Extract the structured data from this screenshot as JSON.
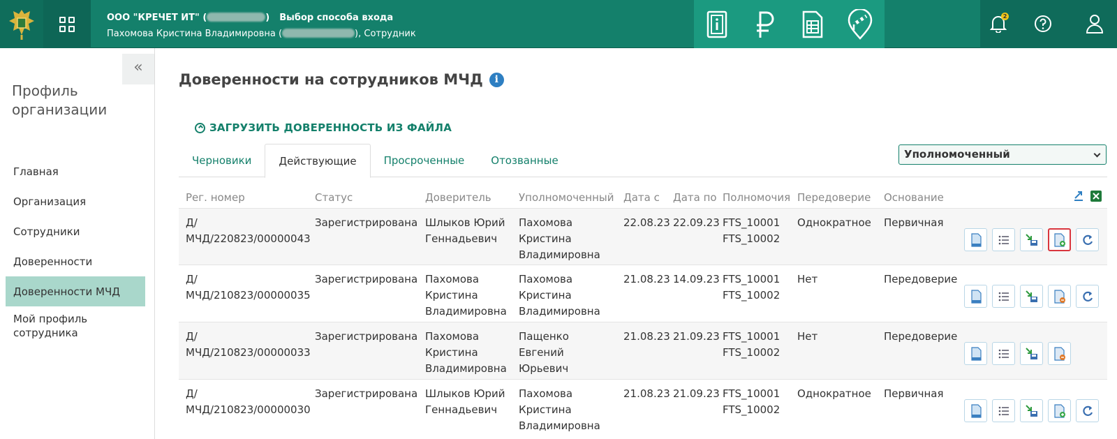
{
  "header": {
    "org_name": "ООО \"КРЕЧЕТ ИТ\" (",
    "org_name_tail": ")",
    "login_choice": "Выбор способа входа",
    "user_name": "Пахомова Кристина Владимировна (",
    "user_role": "), Сотрудник",
    "notification_count": "2",
    "colors": {
      "header_bg": "#14806b",
      "services_bg": "#1b9a80",
      "accent": "#14806b"
    }
  },
  "sidebar": {
    "collapse_label": "«",
    "title": "Профиль организации",
    "items": [
      {
        "label": "Главная"
      },
      {
        "label": "Организация"
      },
      {
        "label": "Сотрудники"
      },
      {
        "label": "Доверенности"
      },
      {
        "label": "Доверенности МЧД"
      },
      {
        "label": "Мой профиль сотрудника"
      }
    ]
  },
  "main": {
    "title": "Доверенности на сотрудников МЧД",
    "info_icon": "i",
    "upload_label": "ЗАГРУЗИТЬ ДОВЕРЕННОСТЬ ИЗ ФАЙЛА",
    "tabs": [
      {
        "label": "Черновики"
      },
      {
        "label": "Действующие"
      },
      {
        "label": "Просроченные"
      },
      {
        "label": "Отозванные"
      }
    ],
    "filter_select": {
      "value": "Уполномоченный"
    }
  },
  "table": {
    "headers": [
      "Рег. номер",
      "Статус",
      "Доверитель",
      "Уполномоченный",
      "Дата с",
      "Дата по",
      "Полномочия",
      "Передоверие",
      "Основание"
    ],
    "rows": [
      {
        "reg1": "Д/",
        "reg2": "МЧД/220823/00000043",
        "status": "Зарегистрирована",
        "principal1": "Шлыков Юрий",
        "principal2": "Геннадьевич",
        "principal3": "",
        "agent1": "Пахомова",
        "agent2": "Кристина",
        "agent3": "Владимировна",
        "date_from": "22.08.23",
        "date_to": "22.09.23",
        "power1": "FTS_10001",
        "power2": "FTS_10002",
        "redelegation": "Однократное",
        "basis": "Первичная"
      },
      {
        "reg1": "Д/",
        "reg2": "МЧД/210823/00000035",
        "status": "Зарегистрирована",
        "principal1": "Пахомова",
        "principal2": "Кристина",
        "principal3": "Владимировна",
        "agent1": "Пахомова",
        "agent2": "Кристина",
        "agent3": "Владимировна",
        "date_from": "21.08.23",
        "date_to": "14.09.23",
        "power1": "FTS_10001",
        "power2": "FTS_10002",
        "redelegation": "Нет",
        "basis": "Передоверие"
      },
      {
        "reg1": "Д/",
        "reg2": "МЧД/210823/00000033",
        "status": "Зарегистрирована",
        "principal1": "Пахомова",
        "principal2": "Кристина",
        "principal3": "Владимировна",
        "agent1": "Пащенко",
        "agent2": "Евгений",
        "agent3": "Юрьевич",
        "date_from": "21.08.23",
        "date_to": "21.09.23",
        "power1": "FTS_10001",
        "power2": "FTS_10002",
        "redelegation": "Нет",
        "basis": "Передоверие"
      },
      {
        "reg1": "Д/",
        "reg2": "МЧД/210823/00000030",
        "status": "Зарегистрирована",
        "principal1": "Шлыков Юрий",
        "principal2": "Геннадьевич",
        "principal3": "",
        "agent1": "Пахомова",
        "agent2": "Кристина",
        "agent3": "Владимировна",
        "date_from": "21.08.23",
        "date_to": "21.09.23",
        "power1": "FTS_10001",
        "power2": "FTS_10002",
        "redelegation": "Однократное",
        "basis": "Первичная"
      }
    ],
    "row_actions": [
      "view-document-icon",
      "list-icon",
      "export-xml-icon",
      "add-document-icon",
      "revoke-icon"
    ],
    "highlighted_action": "add-document-icon"
  }
}
